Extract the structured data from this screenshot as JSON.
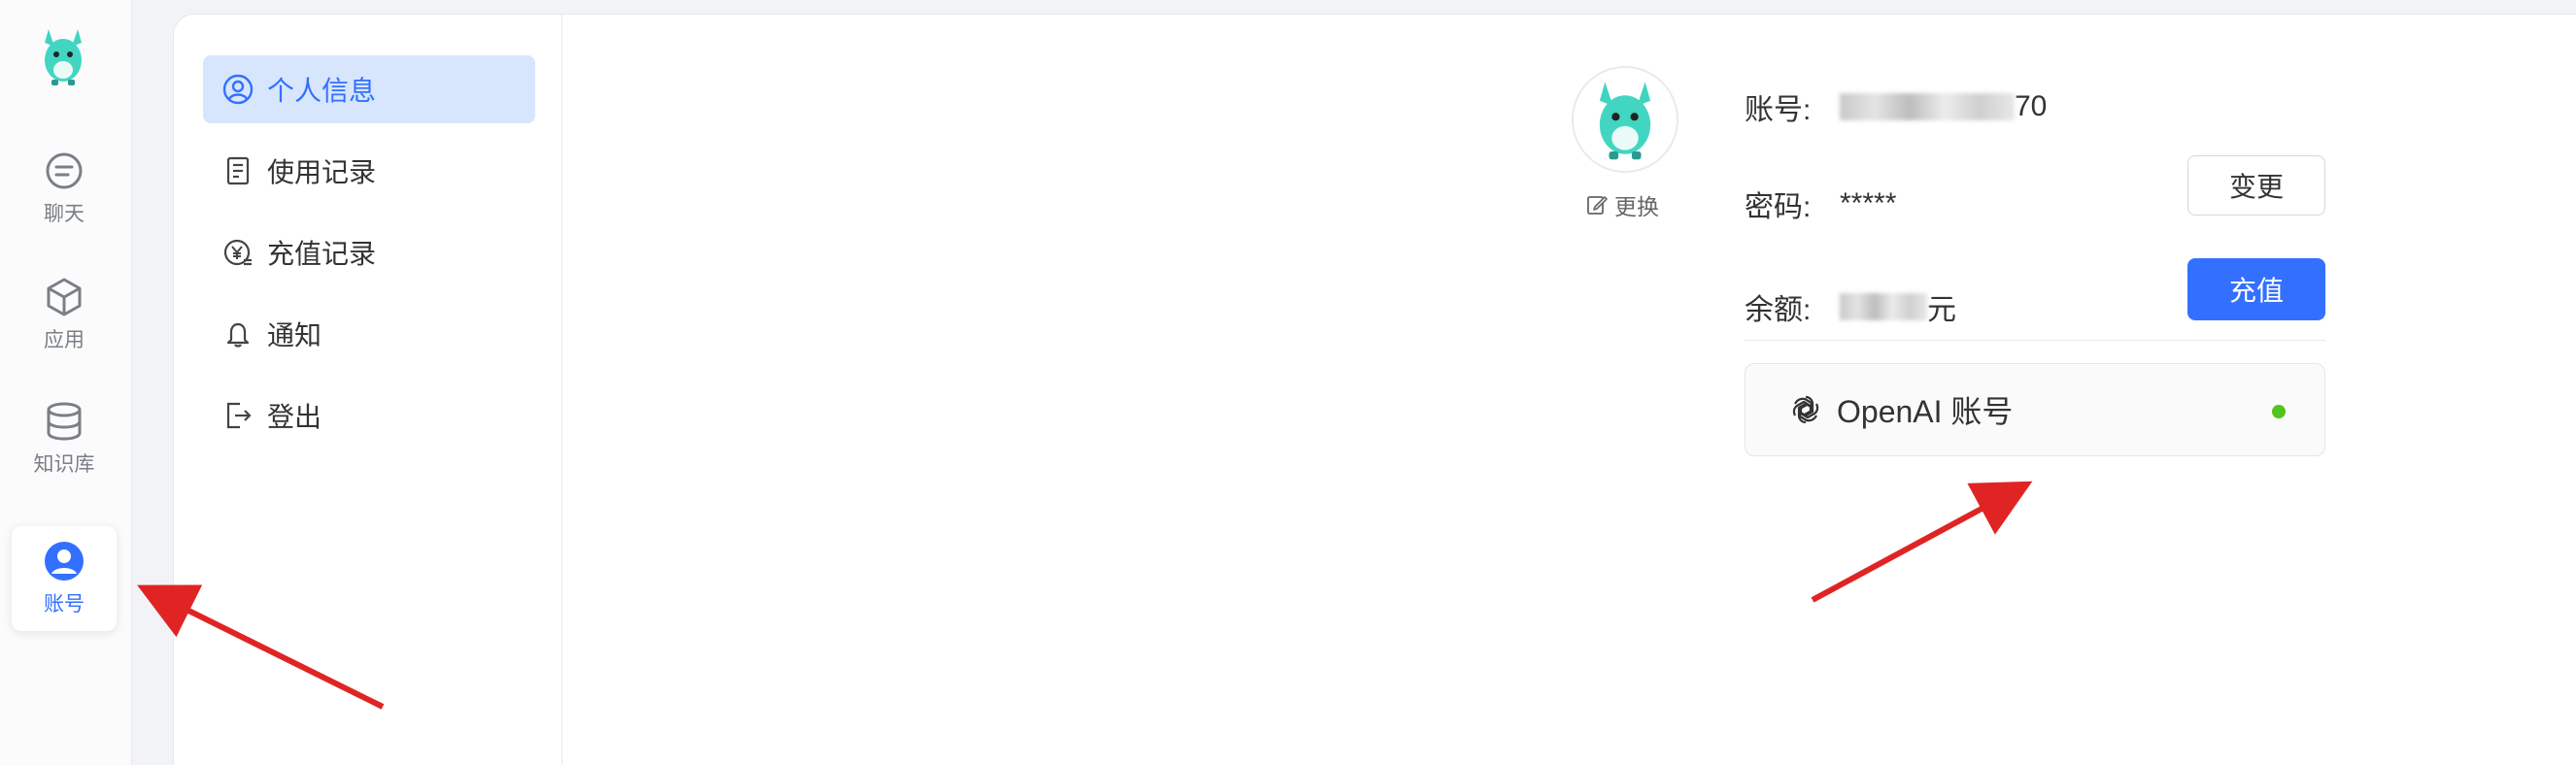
{
  "nav": {
    "items": [
      {
        "label": "聊天",
        "icon": "chat-icon"
      },
      {
        "label": "应用",
        "icon": "cube-icon"
      },
      {
        "label": "知识库",
        "icon": "database-icon"
      },
      {
        "label": "账号",
        "icon": "user-icon",
        "active": true
      }
    ]
  },
  "submenu": {
    "items": [
      {
        "label": "个人信息",
        "icon": "user-circle-icon",
        "active": true
      },
      {
        "label": "使用记录",
        "icon": "document-icon"
      },
      {
        "label": "充值记录",
        "icon": "yen-coin-icon"
      },
      {
        "label": "通知",
        "icon": "bell-icon"
      },
      {
        "label": "登出",
        "icon": "logout-icon"
      }
    ]
  },
  "profile": {
    "change_avatar": "更换",
    "account_label": "账号:",
    "account_value_tail": "70",
    "password_label": "密码:",
    "password_value": "*****",
    "change_button": "变更",
    "balance_label": "余额:",
    "balance_unit": "元",
    "recharge_button": "充值",
    "openai_account": "OpenAI 账号",
    "openai_status_color": "#52c41a"
  },
  "colors": {
    "accent": "#3370ff",
    "active_bg": "#d7e6fd",
    "arrow": "#e02424"
  }
}
